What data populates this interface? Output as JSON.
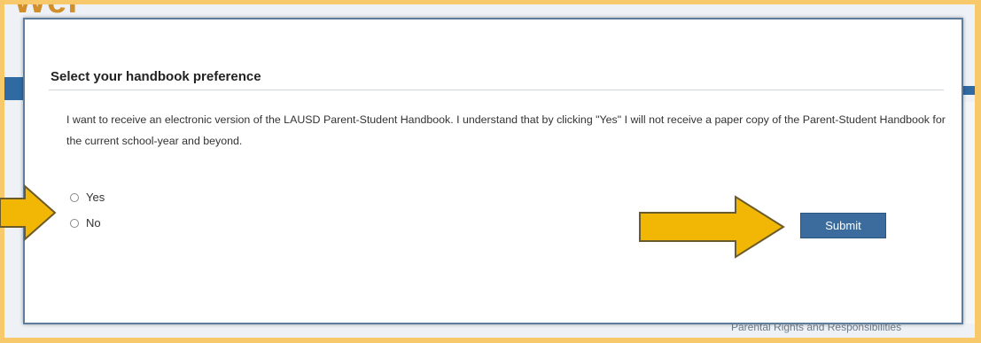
{
  "background": {
    "partial_heading": "Wel",
    "bottom_text": "Parental Rights and Responsibilities"
  },
  "dialog": {
    "title": "Select your handbook preference",
    "body": "I want to receive an electronic version of the LAUSD Parent-Student Handbook. I understand that by clicking \"Yes\" I will not receive a paper copy of the Parent-Student Handbook for the current school-year and beyond.",
    "options": [
      {
        "label": "Yes",
        "selected": false
      },
      {
        "label": "No",
        "selected": false
      }
    ],
    "submit_label": "Submit"
  },
  "colors": {
    "frame": "#f7c96a",
    "arrow_fill": "#f2b705",
    "button": "#3b6c9d"
  }
}
